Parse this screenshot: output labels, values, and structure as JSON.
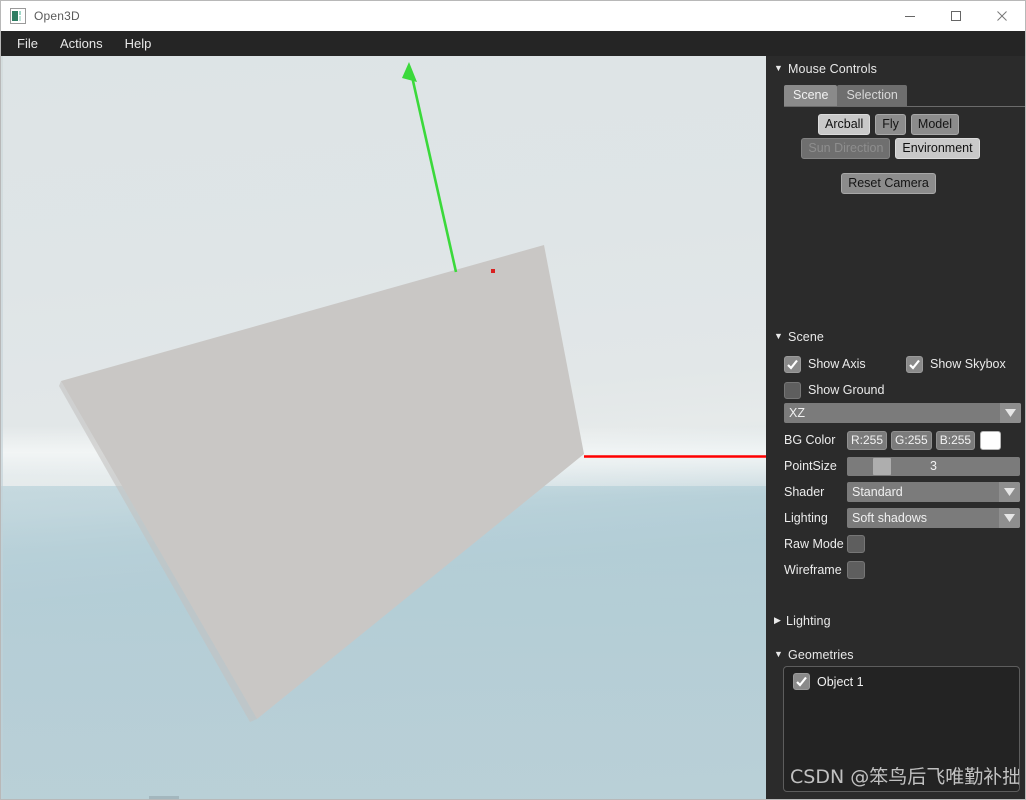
{
  "window": {
    "title": "Open3D",
    "icon": "open3d-logo-icon",
    "minimize_label": "—",
    "maximize_label": "□",
    "close_label": "✕"
  },
  "menubar": {
    "items": [
      {
        "label": "File"
      },
      {
        "label": "Actions"
      },
      {
        "label": "Help"
      }
    ]
  },
  "viewport": {
    "name": "3d-scene-viewport",
    "sky_color": "#dde4e6",
    "ground_color": "#b5cdd6",
    "mesh_color": "#c8c6c4",
    "axis_x_color": "#ff0000",
    "axis_y_color": "#3bd93b",
    "point_color": "#d92020"
  },
  "mouse_controls": {
    "title": "Mouse Controls",
    "expanded": true,
    "triangle": "▼",
    "tabs": [
      {
        "label": "Scene",
        "active": true
      },
      {
        "label": "Selection",
        "active": false
      }
    ],
    "camera_modes": [
      {
        "label": "Arcball",
        "state": "toggled"
      },
      {
        "label": "Fly",
        "state": "normal"
      },
      {
        "label": "Model",
        "state": "normal"
      }
    ],
    "light_modes": [
      {
        "label": "Sun Direction",
        "state": "disabled"
      },
      {
        "label": "Environment",
        "state": "toggled"
      }
    ],
    "reset_camera_label": "Reset Camera"
  },
  "scene": {
    "title": "Scene",
    "expanded": true,
    "triangle": "▼",
    "show_axis": {
      "label": "Show Axis",
      "checked": true
    },
    "show_skybox": {
      "label": "Show Skybox",
      "checked": true
    },
    "show_ground": {
      "label": "Show Ground",
      "checked": false
    },
    "ground_plane": {
      "value": "XZ",
      "arrow": "▼"
    },
    "bg_color": {
      "label": "BG Color",
      "r": "R:255",
      "g": "G:255",
      "b": "B:255",
      "swatch_hex": "#ffffff"
    },
    "point_size": {
      "label": "PointSize",
      "value": "3"
    },
    "shader": {
      "label": "Shader",
      "value": "Standard",
      "arrow": "▼"
    },
    "lighting_profile": {
      "label": "Lighting",
      "value": "Soft shadows",
      "arrow": "▼"
    },
    "raw_mode": {
      "label": "Raw Mode",
      "checked": false
    },
    "wireframe": {
      "label": "Wireframe",
      "checked": false
    }
  },
  "lighting_section": {
    "title": "Lighting",
    "expanded": false,
    "triangle": "▶"
  },
  "geometries": {
    "title": "Geometries",
    "expanded": true,
    "triangle": "▼",
    "items": [
      {
        "label": "Object 1",
        "checked": true
      }
    ]
  },
  "watermark": {
    "text": "CSDN @笨鸟后飞唯勤补拙"
  }
}
